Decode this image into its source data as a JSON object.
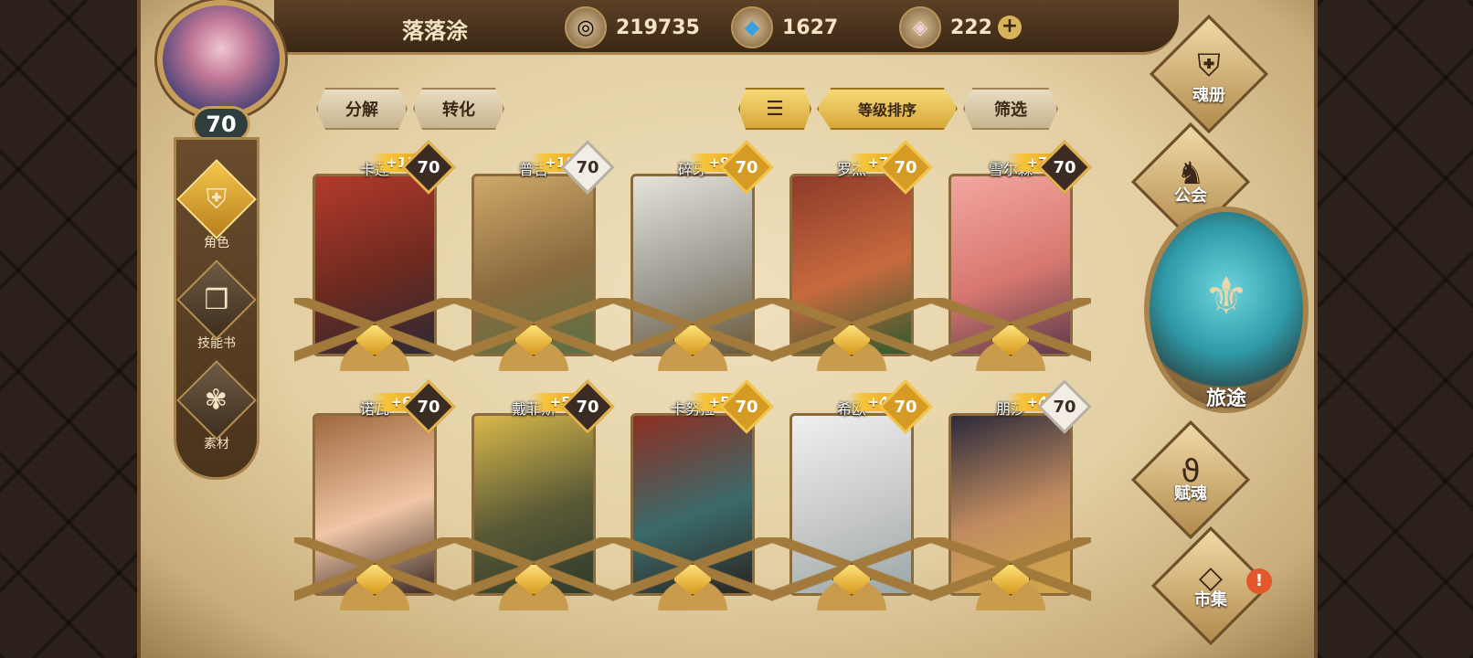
{
  "player": {
    "name": "落落涂",
    "level": "70"
  },
  "currencies": [
    {
      "id": "gold",
      "value": "219735"
    },
    {
      "id": "crystal",
      "value": "1627"
    },
    {
      "id": "gem",
      "value": "222"
    }
  ],
  "left_nav": [
    {
      "label": "角色",
      "active": true
    },
    {
      "label": "技能书",
      "active": false
    },
    {
      "label": "素材",
      "active": false
    }
  ],
  "actions": {
    "decompose": "分解",
    "convert": "转化",
    "sort_level": "等级排序",
    "filter": "筛选"
  },
  "cards": [
    {
      "name": "卡莲",
      "bonus": "+11",
      "level": "70",
      "frame": "dark",
      "art": [
        "#b33a2c",
        "#6e2a1f",
        "#2c2a35"
      ]
    },
    {
      "name": "普吉",
      "bonus": "+10",
      "level": "70",
      "frame": "silver",
      "art": [
        "#cfa96a",
        "#8a6a3e",
        "#5b7044"
      ]
    },
    {
      "name": "碎牙",
      "bonus": "+9",
      "level": "70",
      "frame": "gold",
      "art": [
        "#e6e3da",
        "#9c9a92",
        "#6b5a3a"
      ]
    },
    {
      "name": "罗杰",
      "bonus": "+7",
      "level": "70",
      "frame": "gold",
      "art": [
        "#8f3a2a",
        "#c66a3e",
        "#2e5a2e"
      ]
    },
    {
      "name": "雪尔森",
      "bonus": "+7",
      "level": "70",
      "frame": "dark",
      "art": [
        "#f2a7a0",
        "#d87870",
        "#5c3a4a"
      ]
    },
    {
      "name": "诺瓦",
      "bonus": "+6",
      "level": "70",
      "frame": "dark",
      "art": [
        "#a0683e",
        "#f0c6a6",
        "#3a2a24"
      ]
    },
    {
      "name": "戴菲斯",
      "bonus": "+5",
      "level": "70",
      "frame": "dark",
      "art": [
        "#d8b84a",
        "#5a5a36",
        "#2e3a2a"
      ]
    },
    {
      "name": "卡努拉",
      "bonus": "+5",
      "level": "70",
      "frame": "gold",
      "art": [
        "#8e2f22",
        "#3a6a6a",
        "#2a2420"
      ]
    },
    {
      "name": "希欧",
      "bonus": "+4",
      "level": "70",
      "frame": "gold",
      "art": [
        "#f0f0f0",
        "#c8c8c8",
        "#9aa7a8"
      ]
    },
    {
      "name": "朋莎",
      "bonus": "+4",
      "level": "70",
      "frame": "silver",
      "art": [
        "#2b2a3a",
        "#c28c60",
        "#d3a948"
      ]
    }
  ],
  "right_menu": {
    "soul_book": "魂册",
    "guild": "公会",
    "journey": "旅途",
    "empower": "赋魂",
    "market": "市集",
    "market_alert": "!"
  }
}
